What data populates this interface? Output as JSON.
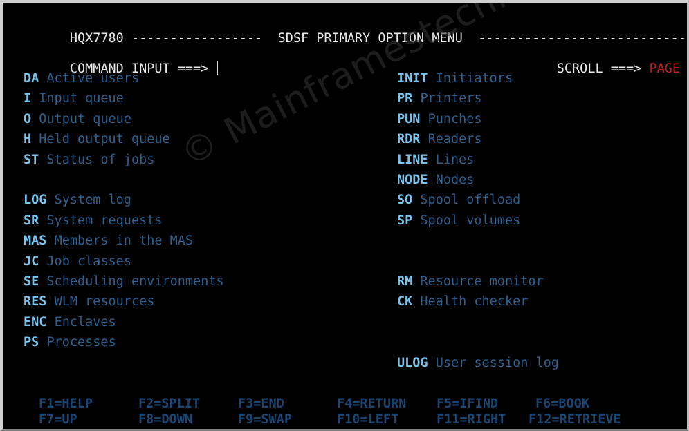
{
  "header": {
    "panel_id": "HQX7780",
    "left_rule": "-----------------",
    "title": "SDSF PRIMARY OPTION MENU",
    "right_rule": "----------------------------"
  },
  "command_line": {
    "label": "COMMAND INPUT ===>",
    "value": "",
    "cursor_visible": true,
    "scroll_label": "SCROLL ===>",
    "scroll_value": "PAGE"
  },
  "options": {
    "left_column": [
      {
        "code": "DA",
        "description": "Active users"
      },
      {
        "code": "I",
        "description": "Input queue"
      },
      {
        "code": "O",
        "description": "Output queue"
      },
      {
        "code": "H",
        "description": "Held output queue"
      },
      {
        "code": "ST",
        "description": "Status of jobs"
      },
      {
        "code": "",
        "description": ""
      },
      {
        "code": "LOG",
        "description": "System log"
      },
      {
        "code": "SR",
        "description": "System requests"
      },
      {
        "code": "MAS",
        "description": "Members in the MAS"
      },
      {
        "code": "JC",
        "description": "Job classes"
      },
      {
        "code": "SE",
        "description": "Scheduling environments"
      },
      {
        "code": "RES",
        "description": "WLM resources"
      },
      {
        "code": "ENC",
        "description": "Enclaves"
      },
      {
        "code": "PS",
        "description": "Processes"
      }
    ],
    "right_column": [
      {
        "code": "INIT",
        "description": "Initiators"
      },
      {
        "code": "PR",
        "description": "Printers"
      },
      {
        "code": "PUN",
        "description": "Punches"
      },
      {
        "code": "RDR",
        "description": "Readers"
      },
      {
        "code": "LINE",
        "description": "Lines"
      },
      {
        "code": "NODE",
        "description": "Nodes"
      },
      {
        "code": "SO",
        "description": "Spool offload"
      },
      {
        "code": "SP",
        "description": "Spool volumes"
      },
      {
        "code": "",
        "description": ""
      },
      {
        "code": "",
        "description": ""
      },
      {
        "code": "RM",
        "description": "Resource monitor"
      },
      {
        "code": "CK",
        "description": "Health checker"
      },
      {
        "code": "",
        "description": ""
      },
      {
        "code": "",
        "description": ""
      },
      {
        "code": "ULOG",
        "description": "User session log"
      }
    ]
  },
  "function_keys": {
    "row1": [
      "F1=HELP",
      "F2=SPLIT",
      "F3=END",
      "F4=RETURN",
      "F5=IFIND",
      "F6=BOOK"
    ],
    "row2": [
      "F7=UP",
      "F8=DOWN",
      "F9=SWAP",
      "F10=LEFT",
      "F11=RIGHT",
      "F12=RETRIEVE"
    ]
  },
  "watermark": {
    "text": "© Mainframestechhelp"
  },
  "colors": {
    "background": "#000000",
    "title_text": "#e8e8e8",
    "option_code": "#79c3ec",
    "option_description": "#2d5f8e",
    "scroll_value": "#c02020",
    "function_key": "#1c4572",
    "frame": "#cfcfcf"
  }
}
